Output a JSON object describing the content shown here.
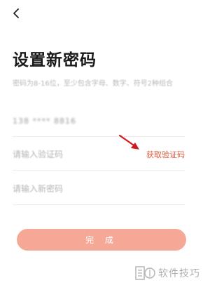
{
  "header": {
    "back_icon": "chevron-left-icon"
  },
  "title": "设置新密码",
  "subtitle": "密码为8-16位，至少包含字母、数字、符号2种组合",
  "phone": {
    "value": "138 **** 8816"
  },
  "code": {
    "placeholder": "请输入验证码",
    "get_code_label": "获取验证码"
  },
  "password": {
    "placeholder": "请输入新密码"
  },
  "submit_label": "完  成",
  "watermark": {
    "text": "软件技巧"
  },
  "colors": {
    "accent": "#e05a3c",
    "button": "#f6a897",
    "arrow": "#d01820"
  }
}
